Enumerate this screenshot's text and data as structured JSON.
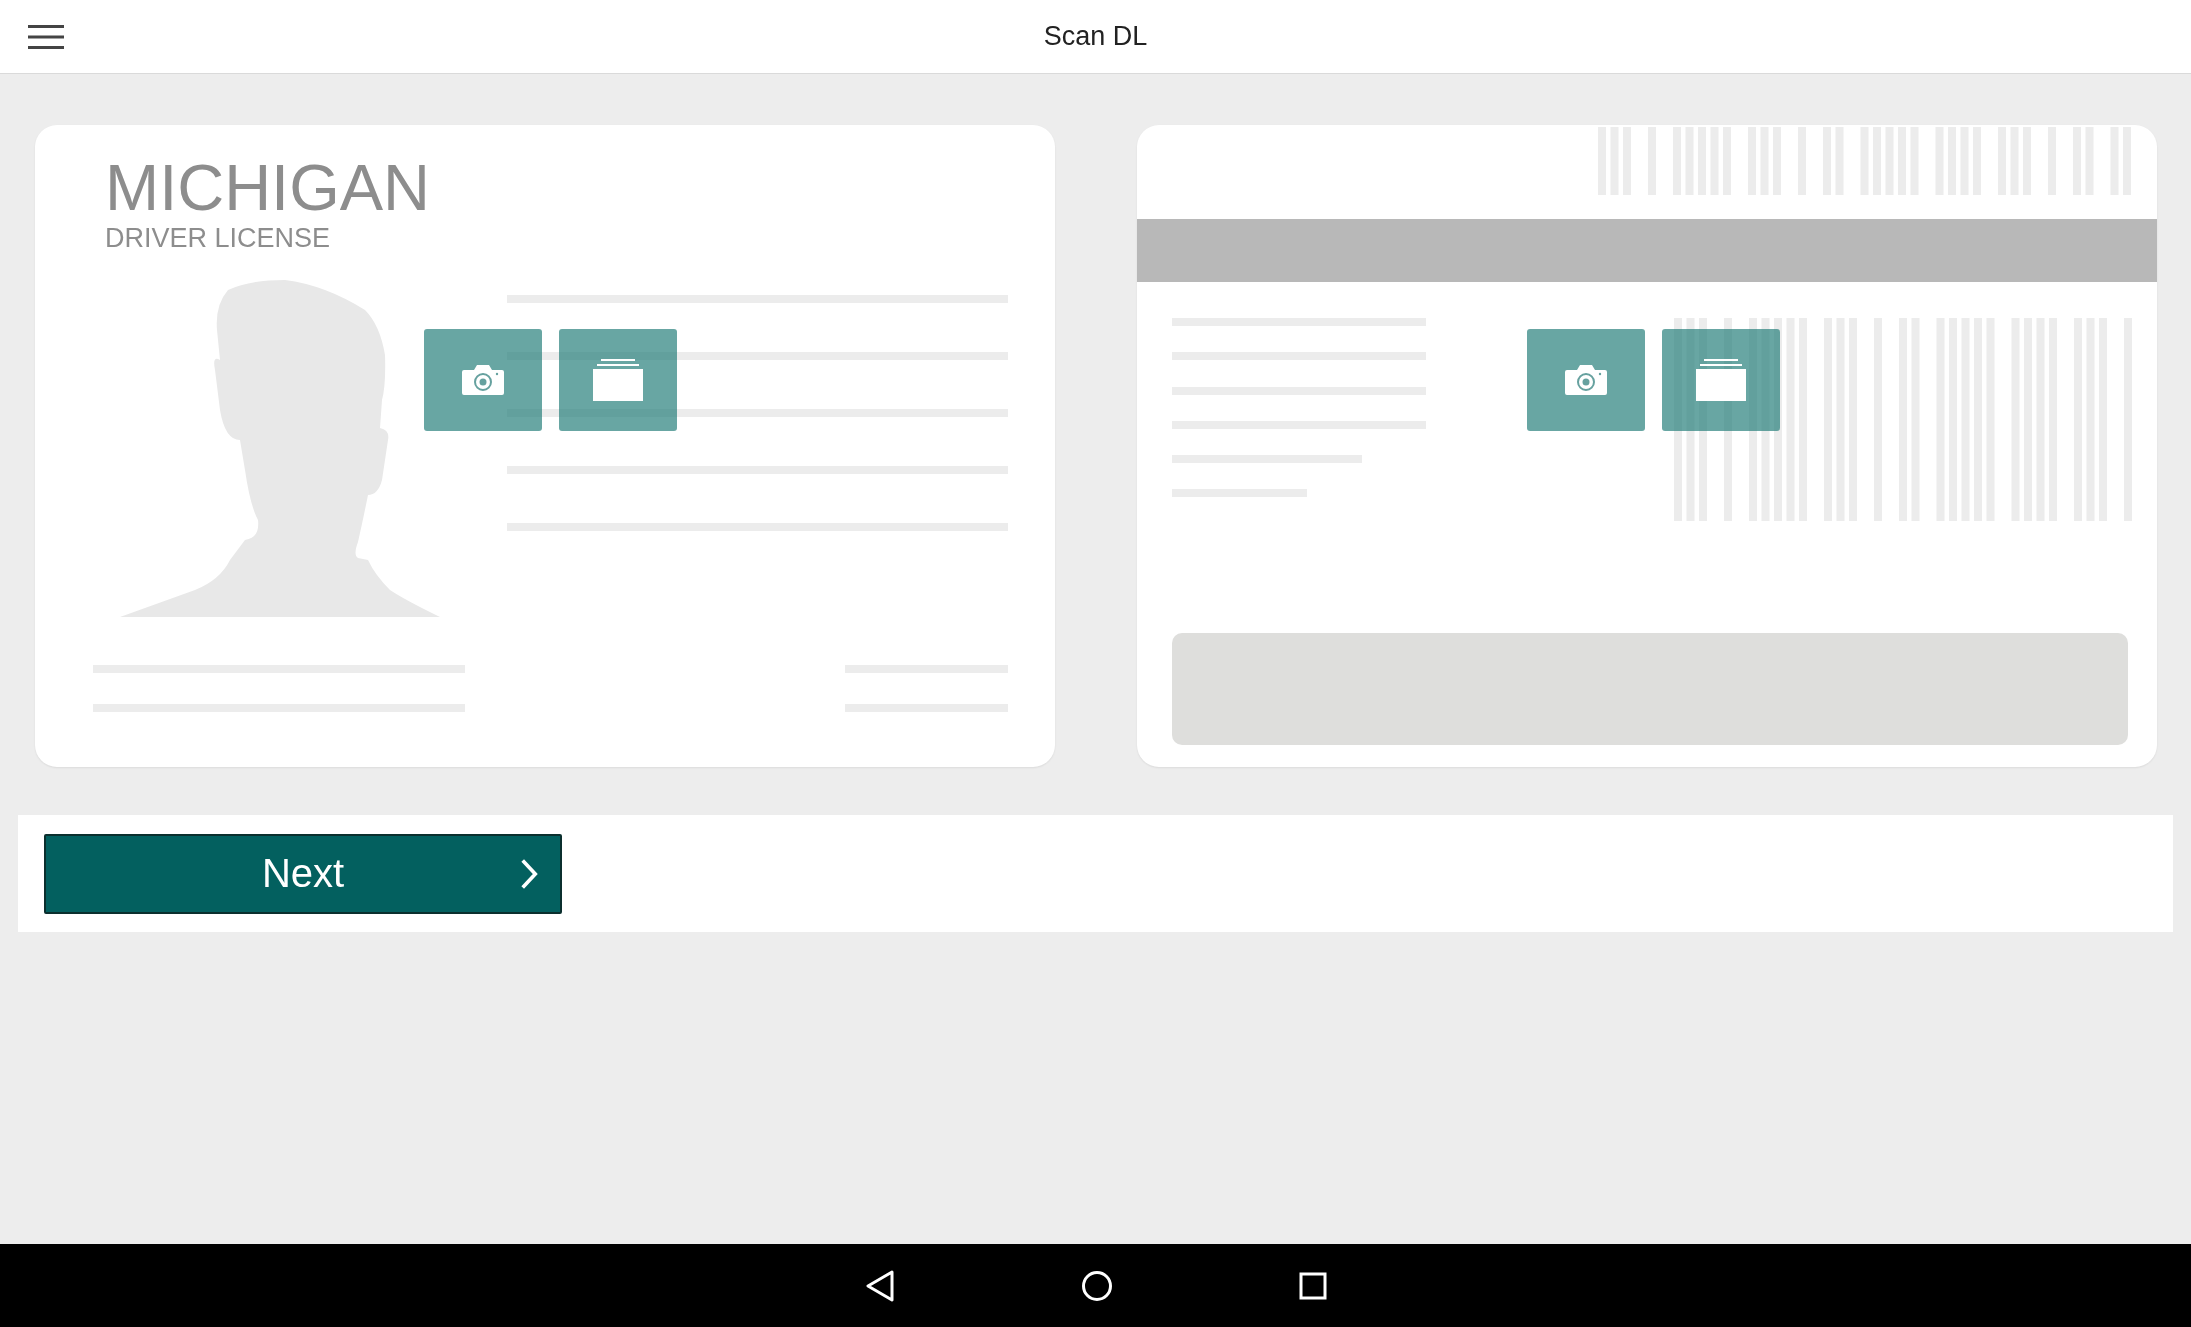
{
  "app_bar": {
    "title": "Scan DL"
  },
  "front_card": {
    "state_name": "MICHIGAN",
    "document_type": "DRIVER LICENSE"
  },
  "next_button": {
    "label": "Next"
  }
}
